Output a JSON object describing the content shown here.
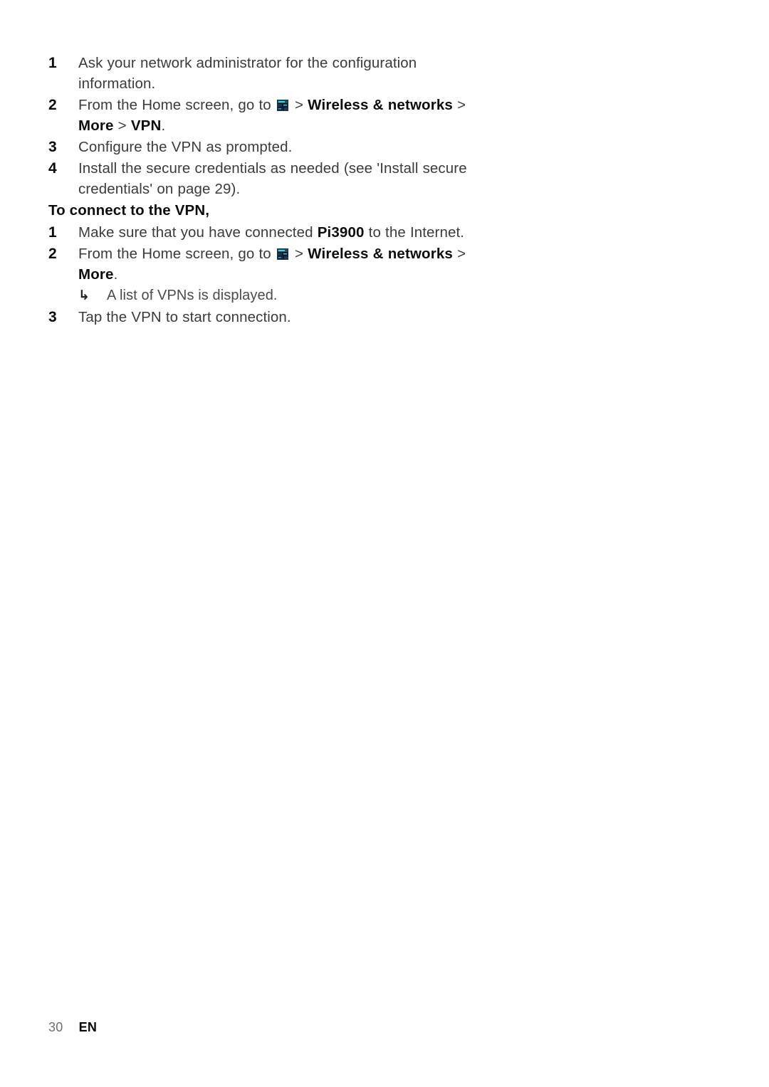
{
  "document": {
    "page_number": "30",
    "language_code": "EN"
  },
  "icons": {
    "settings": "settings-tiles-icon"
  },
  "setup_list": {
    "items": [
      {
        "number": "1",
        "segments": [
          {
            "type": "text",
            "value": "Ask your network administrator for the configuration information."
          }
        ]
      },
      {
        "number": "2",
        "segments": [
          {
            "type": "text",
            "value": "From the Home screen, go to "
          },
          {
            "type": "icon",
            "value": "settings-tiles-icon"
          },
          {
            "type": "sep",
            "value": " > "
          },
          {
            "type": "bold",
            "value": "Wireless & networks"
          },
          {
            "type": "sep",
            "value": " > "
          },
          {
            "type": "bold",
            "value": "More"
          },
          {
            "type": "sep",
            "value": " > "
          },
          {
            "type": "bold",
            "value": "VPN"
          },
          {
            "type": "text",
            "value": "."
          }
        ]
      },
      {
        "number": "3",
        "segments": [
          {
            "type": "text",
            "value": "Configure the VPN as prompted."
          }
        ]
      },
      {
        "number": "4",
        "segments": [
          {
            "type": "text",
            "value": "Install the secure credentials as needed (see 'Install secure credentials' on page 29)."
          }
        ]
      }
    ]
  },
  "connect_heading": "To connect to the VPN,",
  "connect_list": {
    "items": [
      {
        "number": "1",
        "segments": [
          {
            "type": "text",
            "value": "Make sure that you have connected "
          },
          {
            "type": "bold",
            "value": "Pi3900"
          },
          {
            "type": "text",
            "value": " to the Internet."
          }
        ]
      },
      {
        "number": "2",
        "segments": [
          {
            "type": "text",
            "value": "From the Home screen, go to "
          },
          {
            "type": "icon",
            "value": "settings-tiles-icon"
          },
          {
            "type": "sep",
            "value": " > "
          },
          {
            "type": "bold",
            "value": "Wireless & networks"
          },
          {
            "type": "sep",
            "value": " > "
          },
          {
            "type": "bold",
            "value": "More"
          },
          {
            "type": "text",
            "value": "."
          }
        ],
        "note": {
          "arrow": "↳",
          "text": "A list of VPNs is displayed."
        }
      },
      {
        "number": "3",
        "segments": [
          {
            "type": "text",
            "value": "Tap the VPN to start connection."
          }
        ]
      }
    ]
  }
}
